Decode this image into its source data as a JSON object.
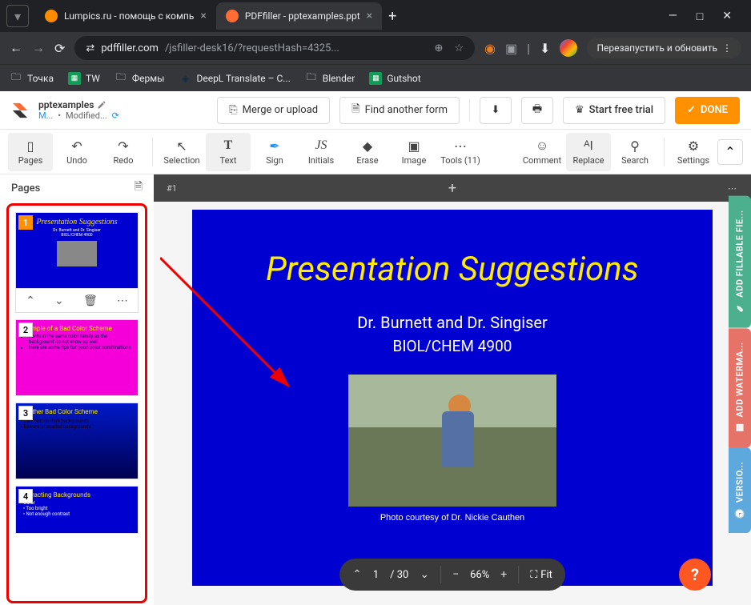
{
  "browser": {
    "tabs": [
      {
        "title": "Lumpics.ru - помощь с компь",
        "favicon": "#ff8c00",
        "active": false
      },
      {
        "title": "PDFfiller - pptexamples.ppt",
        "favicon": "#ff6b35",
        "active": true
      }
    ],
    "url_domain": "pdffiller.com",
    "url_path": "/jsfiller-desk16/?requestHash=4325...",
    "restart_label": "Перезапустить и обновить"
  },
  "bookmarks": [
    {
      "label": "Точка",
      "icon": "folder"
    },
    {
      "label": "TW",
      "icon": "sheets"
    },
    {
      "label": "Фермы",
      "icon": "folder"
    },
    {
      "label": "DeepL Translate – C...",
      "icon": "deepl"
    },
    {
      "label": "Blender",
      "icon": "folder"
    },
    {
      "label": "Gutshot",
      "icon": "sheets"
    }
  ],
  "doc": {
    "title": "pptexamples",
    "meta_user": "M...",
    "meta_status": "Modified..."
  },
  "header_buttons": {
    "merge": "Merge or upload",
    "find": "Find another form",
    "trial": "Start free trial",
    "done": "DONE"
  },
  "toolbar": [
    {
      "name": "pages",
      "label": "Pages",
      "icon": "▭"
    },
    {
      "name": "undo",
      "label": "Undo",
      "icon": "↶"
    },
    {
      "name": "redo",
      "label": "Redo",
      "icon": "↷"
    },
    {
      "name": "sep"
    },
    {
      "name": "selection",
      "label": "Selection",
      "icon": "↖"
    },
    {
      "name": "text",
      "label": "Text",
      "icon": "T",
      "active": true
    },
    {
      "name": "sign",
      "label": "Sign",
      "icon": "✎"
    },
    {
      "name": "initials",
      "label": "Initials",
      "icon": "JS"
    },
    {
      "name": "erase",
      "label": "Erase",
      "icon": "◆"
    },
    {
      "name": "image",
      "label": "Image",
      "icon": "▣"
    },
    {
      "name": "tools",
      "label": "Tools (11)",
      "icon": "⋯"
    },
    {
      "name": "sep"
    },
    {
      "name": "comment",
      "label": "Comment",
      "icon": "☺"
    },
    {
      "name": "replace",
      "label": "Replace",
      "icon": "AI",
      "active": true
    },
    {
      "name": "search",
      "label": "Search",
      "icon": "⚲"
    },
    {
      "name": "sep"
    },
    {
      "name": "settings",
      "label": "Settings",
      "icon": "⚙"
    }
  ],
  "sidebar": {
    "title": "Pages"
  },
  "thumbs": [
    {
      "num": "1",
      "title": "Presentation Suggestions",
      "sub": "Dr. Burnett and Dr. Singiser",
      "sub2": "BIOL/CHEM 4900"
    },
    {
      "num": "2",
      "title": "Example of a Bad Color Scheme"
    },
    {
      "num": "3",
      "title": "Another Bad Color Scheme"
    },
    {
      "num": "4",
      "title": "Distracting Backgrounds"
    }
  ],
  "canvas": {
    "page_label": "#1"
  },
  "slide": {
    "title": "Presentation Suggestions",
    "sub1": "Dr. Burnett and Dr. Singiser",
    "sub2": "BIOL/CHEM 4900",
    "caption": "Photo courtesy of Dr. Nickie Cauthen"
  },
  "page_nav": {
    "current": "1",
    "total": "/ 30",
    "zoom": "66%",
    "fit": "Fit"
  },
  "right_tabs": {
    "fillable": "ADD FILLABLE FIE...",
    "watermark": "ADD WATERMA...",
    "versions": "VERSIO..."
  }
}
